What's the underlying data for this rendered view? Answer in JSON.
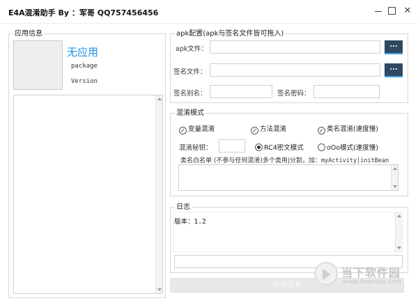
{
  "window": {
    "title": "E4A混淆助手 By ：军哥 QQ757456456"
  },
  "app_info": {
    "group_title": "应用信息",
    "app_name": "无应用",
    "package_label": "package",
    "version_label": "Version"
  },
  "apk_config": {
    "group_title": "apk配置(apk与签名文件皆可拖入)",
    "apk_file_label": "apk文件：",
    "apk_file_value": "",
    "browse_label": "...",
    "sign_file_label": "签名文件：",
    "sign_file_value": "",
    "sign_alias_label": "签名别名：",
    "sign_alias_value": "",
    "sign_password_label": "签名密码：",
    "sign_password_value": ""
  },
  "obfuscation": {
    "group_title": "混淆模式",
    "var_obfuscation": "变量混淆",
    "method_obfuscation": "方法混淆",
    "class_obfuscation": "类名混淆(速度慢)",
    "key_label": "混淆秘钥：",
    "key_value": "",
    "rc4_mode": "RC4密文模式",
    "ooo_mode": "oOo模式(速度慢)",
    "whitelist_hint": "类名白名单 (不参与任何混淆)多个类用|分割，加：",
    "whitelist_example": "myActivity|initBean"
  },
  "log": {
    "group_title": "日志",
    "version_label": "版本：",
    "version_value": "1.2"
  },
  "start_button": "开始混淆",
  "watermark": {
    "name": "当下软件园",
    "url": "www.downxia.com"
  },
  "colors": {
    "accent": "#1e90e8",
    "browse_button": "#2e4a62"
  }
}
